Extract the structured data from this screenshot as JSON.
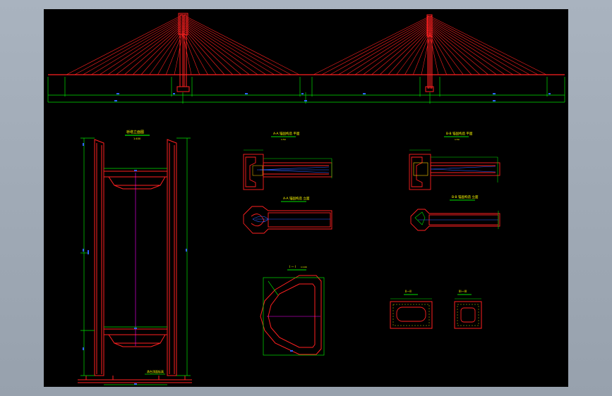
{
  "title": "",
  "labels": {
    "tower_elevation": "桥塔立面图",
    "tower_elevation_scale": "1:400",
    "anchor_a_plan": "A-A 锚固构造 平面",
    "anchor_a_plan_scale": "1:50",
    "anchor_a_elev": "A-A 锚固构造 立面",
    "anchor_b_plan": "B-B 锚固构造 平面",
    "anchor_b_plan_scale": "1:50",
    "anchor_b_elev": "B-B 锚固构造 立面",
    "section_1": "I — I",
    "section_1_scale": "1:100",
    "section_2": "II—II",
    "section_3": "III—III",
    "bottom_note": "承台顶面标高"
  },
  "colors": {
    "background": "#000000",
    "frame": "#9aa4b0",
    "structure": "#ff2020",
    "dimension": "#00e000",
    "text_blue": "#3060ff",
    "text_yellow": "#ffff00",
    "axis": "#ff00ff",
    "hatch": "#ffcc00"
  }
}
